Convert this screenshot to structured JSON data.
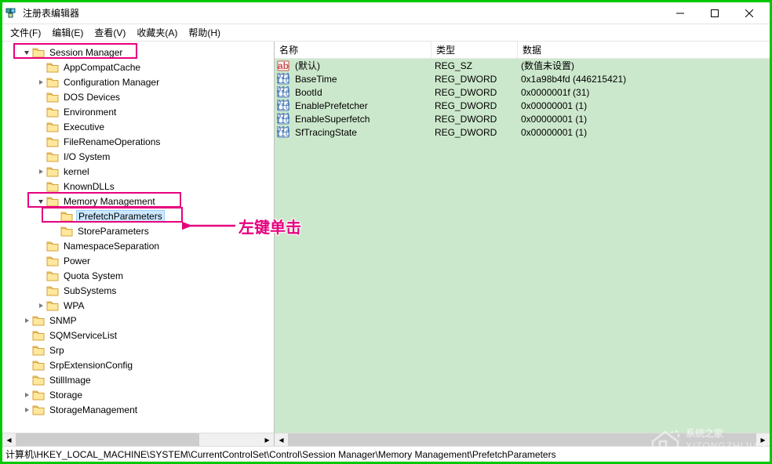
{
  "title": "注册表编辑器",
  "menus": {
    "file": "文件(F)",
    "edit": "编辑(E)",
    "view": "查看(V)",
    "fav": "收藏夹(A)",
    "help": "帮助(H)"
  },
  "tree": {
    "sessionManager": "Session Manager",
    "items": [
      "AppCompatCache",
      "Configuration Manager",
      "DOS Devices",
      "Environment",
      "Executive",
      "FileRenameOperations",
      "I/O System",
      "kernel",
      "KnownDLLs"
    ],
    "memoryManagement": "Memory Management",
    "prefetch": "PrefetchParameters",
    "store": "StoreParameters",
    "after": [
      "NamespaceSeparation",
      "Power",
      "Quota System",
      "SubSystems",
      "WPA"
    ],
    "siblings": [
      "SNMP",
      "SQMServiceList",
      "Srp",
      "SrpExtensionConfig",
      "StillImage",
      "Storage",
      "StorageManagement"
    ]
  },
  "expanders": {
    "cfg": true,
    "kernel": true,
    "wpa": true,
    "snmp": true,
    "storage": true,
    "storageMgmt": true
  },
  "list": {
    "cols": {
      "name": "名称",
      "type": "类型",
      "data": "数据"
    },
    "colw": {
      "name": 200,
      "type": 110,
      "data": 280
    },
    "rows": [
      {
        "icon": "str",
        "name": "(默认)",
        "type": "REG_SZ",
        "data": "(数值未设置)"
      },
      {
        "icon": "bin",
        "name": "BaseTime",
        "type": "REG_DWORD",
        "data": "0x1a98b4fd (446215421)"
      },
      {
        "icon": "bin",
        "name": "BootId",
        "type": "REG_DWORD",
        "data": "0x0000001f (31)"
      },
      {
        "icon": "bin",
        "name": "EnablePrefetcher",
        "type": "REG_DWORD",
        "data": "0x00000001 (1)"
      },
      {
        "icon": "bin",
        "name": "EnableSuperfetch",
        "type": "REG_DWORD",
        "data": "0x00000001 (1)"
      },
      {
        "icon": "bin",
        "name": "SfTracingState",
        "type": "REG_DWORD",
        "data": "0x00000001 (1)"
      }
    ]
  },
  "status": "计算机\\HKEY_LOCAL_MACHINE\\SYSTEM\\CurrentControlSet\\Control\\Session Manager\\Memory Management\\PrefetchParameters",
  "annotation": "左键单击",
  "watermark": {
    "line1": "系统之家",
    "line2": "XITONGZHIJIA.NET"
  }
}
